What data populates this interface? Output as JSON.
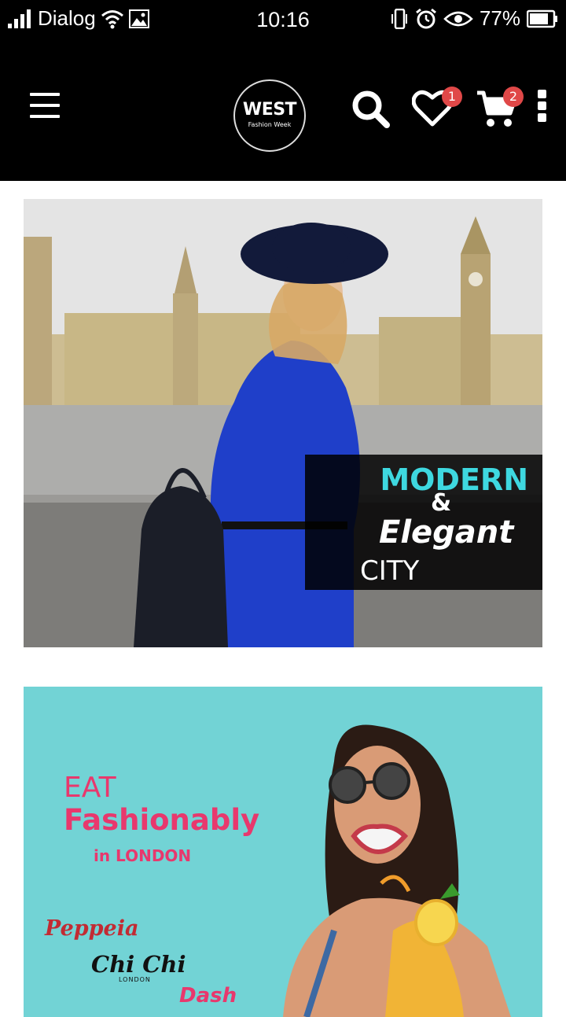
{
  "status_bar": {
    "carrier": "Dialog",
    "time": "10:16",
    "battery": "77%",
    "background": "#000000",
    "icons": [
      "signal-icon",
      "wifi-icon",
      "image-icon",
      "vibrate-icon",
      "alarm-icon",
      "eye-icon",
      "battery-icon"
    ]
  },
  "app_bar": {
    "background": "#000000",
    "logo": {
      "line1": "WEST",
      "line2": "Fashion Week"
    },
    "wishlist_count": "1",
    "cart_count": "2",
    "badge_color": "#e04848",
    "icons": [
      "menu-icon",
      "search-icon",
      "heart-icon",
      "cart-icon",
      "more-vert-icon"
    ]
  },
  "banners": [
    {
      "name": "modern-elegant-city",
      "line1": "MODERN",
      "line2": "&",
      "line3": "Elegant",
      "line4": "CITY",
      "accent_color": "#3ed8e0"
    },
    {
      "name": "eat-fashionably",
      "line1": "EAT",
      "line2": "Fashionably",
      "line3": "in LONDON",
      "brands": [
        "Peppeia",
        "Chi Chi",
        "LONDON",
        "Dash"
      ],
      "accent_color": "#e8386d",
      "background": "#6fd2d4"
    }
  ]
}
